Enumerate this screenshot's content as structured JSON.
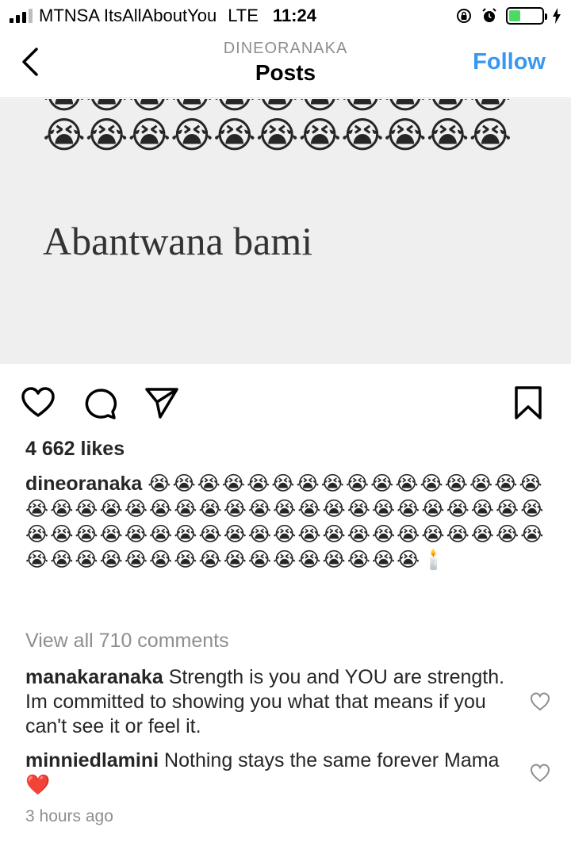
{
  "status_bar": {
    "carrier": "MTNSA ItsAllAboutYou",
    "network": "LTE",
    "time": "11:24",
    "battery_level": 0.35,
    "battery_color": "#4cd964"
  },
  "header": {
    "account": "DINEORANAKA",
    "title": "Posts",
    "follow_label": "Follow",
    "back_icon": "chevron-left-icon",
    "accent_color": "#3897f0"
  },
  "post_image": {
    "emoji_row_partial": "😭😭😭😭😭😭😭😭😭😭😭",
    "emoji_row": "😭😭😭😭😭😭😭😭😭😭😭",
    "text": "Abantwana bami"
  },
  "actions": {
    "like_icon": "heart-icon",
    "comment_icon": "comment-icon",
    "share_icon": "paper-plane-icon",
    "save_icon": "bookmark-icon"
  },
  "likes": "4 662 likes",
  "caption": {
    "username": "dineoranaka",
    "text": "😭😭😭😭😭😭😭😭😭😭😭😭😭😭😭😭😭😭😭😭😭😭😭😭😭😭😭😭😭😭😭😭😭😭😭😭😭😭😭😭😭😭😭😭😭😭😭😭😭😭😭😭😭😭😭😭😭😭😭😭😭😭😭😭😭😭😭😭😭😭😭😭😭😭🕯️"
  },
  "view_all_comments": "View all 710 comments",
  "comments": [
    {
      "username": "manakaranaka",
      "text": "Strength is you and YOU are strength. Im committed to showing you what that means if you can't see it or feel it."
    },
    {
      "username": "minniedlamini",
      "text": "Nothing stays the same forever Mama ❤️"
    }
  ],
  "timestamp": "3 hours ago"
}
